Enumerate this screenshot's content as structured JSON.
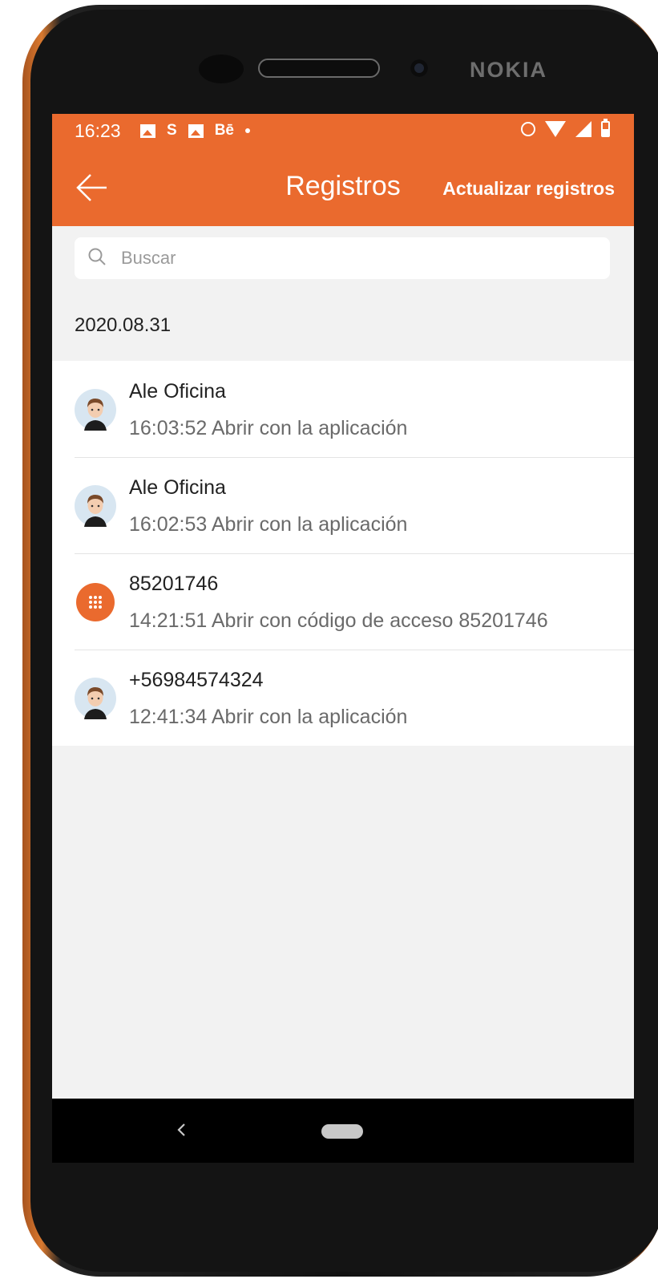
{
  "device": {
    "brand": "NOKIA"
  },
  "status_bar": {
    "time": "16:23",
    "app_badge": "Bē",
    "s_badge": "S"
  },
  "app_bar": {
    "title": "Registros",
    "action_label": "Actualizar registros"
  },
  "search": {
    "placeholder": "Buscar"
  },
  "log": {
    "date": "2020.08.31",
    "items": [
      {
        "title": "Ale Oficina",
        "detail": "16:03:52 Abrir con la aplicación",
        "icon": "user-avatar-icon"
      },
      {
        "title": "Ale Oficina",
        "detail": "16:02:53 Abrir con la aplicación",
        "icon": "user-avatar-icon"
      },
      {
        "title": "85201746",
        "detail": "14:21:51 Abrir con código de acceso 85201746",
        "icon": "keypad-icon"
      },
      {
        "title": "+56984574324",
        "detail": "12:41:34 Abrir con la aplicación",
        "icon": "user-avatar-icon"
      }
    ]
  },
  "colors": {
    "accent": "#ea6a2e",
    "background": "#f2f2f2",
    "text_primary": "#222222",
    "text_secondary": "#6a6a6a"
  }
}
